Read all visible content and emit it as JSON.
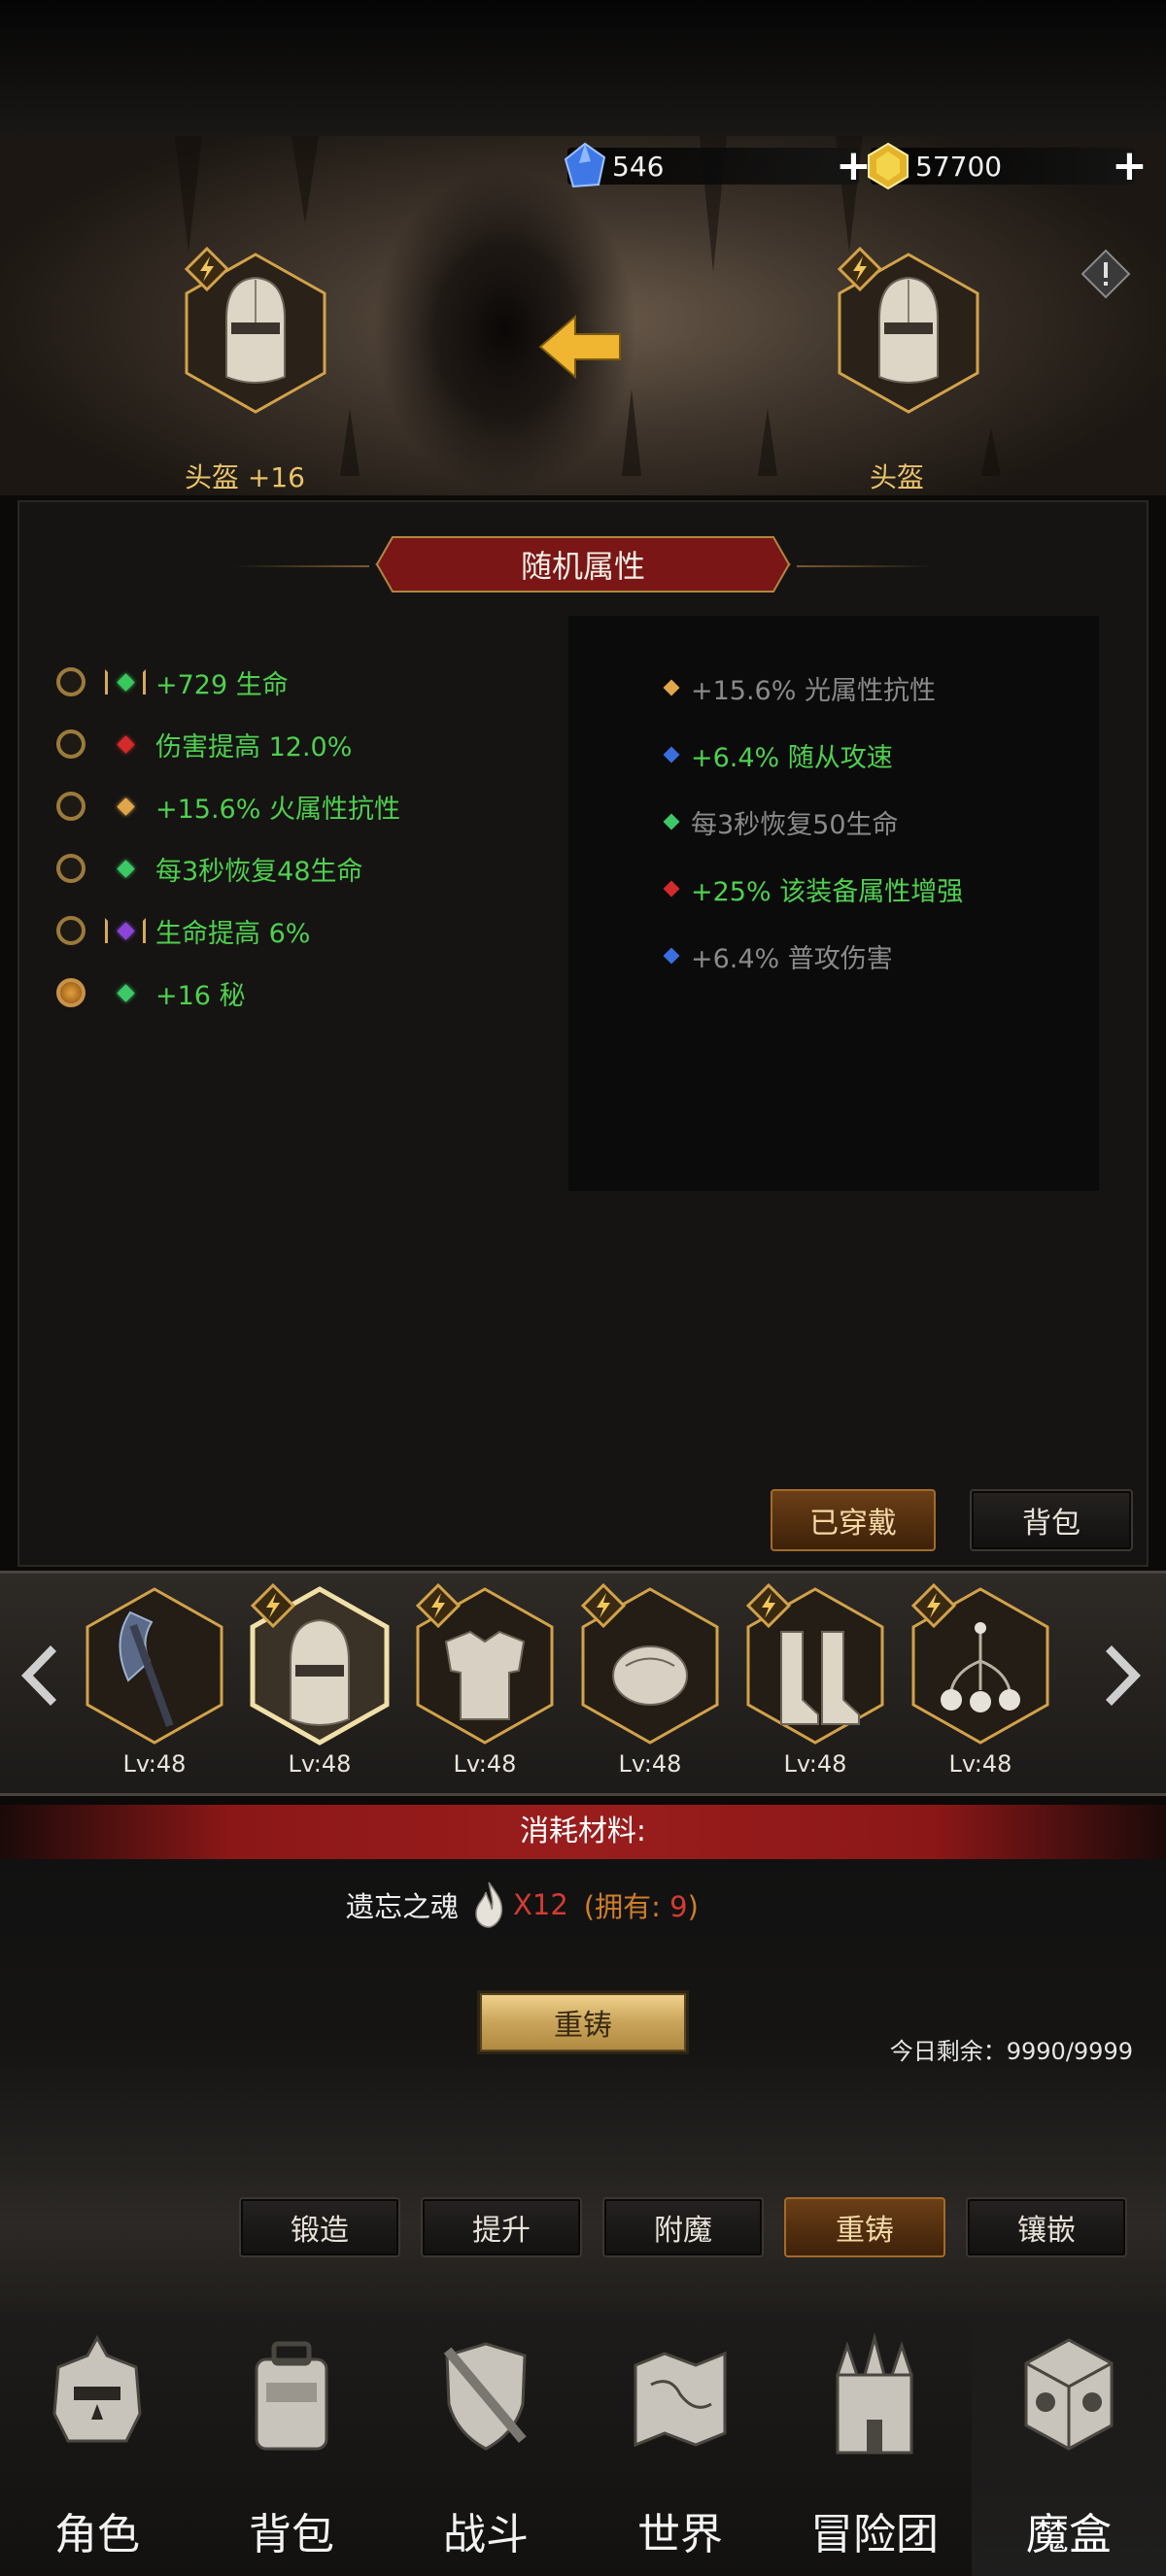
{
  "currency": {
    "diamonds": "546",
    "gold": "57700"
  },
  "compare": {
    "left_label": "头盔 +16",
    "right_label": "头盔"
  },
  "section_title": "随机属性",
  "current_attributes": [
    {
      "text": "+729 生命",
      "color": "#4fd04f",
      "gem": "#39c85a",
      "bracketed": true,
      "bracket_color": "#d7a95a"
    },
    {
      "text": "伤害提高 12.0%",
      "color": "#4fd04f",
      "gem": "#d42a2a",
      "bracketed": false
    },
    {
      "text": "+15.6% 火属性抗性",
      "color": "#4fd04f",
      "gem": "#e0a64a",
      "bracketed": false
    },
    {
      "text": "每3秒恢复48生命",
      "color": "#4fd04f",
      "gem": "#3cc866",
      "bracketed": false
    },
    {
      "text": "生命提高 6%",
      "color": "#4fd04f",
      "gem": "#8b45d6",
      "bracketed": true,
      "bracket_color": "#d7a95a"
    },
    {
      "text": "+16 秘",
      "color": "#4fd04f",
      "gem": "#3cc866",
      "bracketed": false,
      "selected": true
    }
  ],
  "new_attributes": [
    {
      "text": "+15.6% 光属性抗性",
      "color": "#8a8a8a",
      "gem": "#e0a64a"
    },
    {
      "text": "+6.4% 随从攻速",
      "color": "#4fd04f",
      "gem": "#3a6ee0"
    },
    {
      "text": "每3秒恢复50生命",
      "color": "#8a8a8a",
      "gem": "#3cc866"
    },
    {
      "text": "+25% 该装备属性增强",
      "color": "#4fd04f",
      "gem": "#d42a2a"
    },
    {
      "text": "+6.4% 普攻伤害",
      "color": "#8a8a8a",
      "gem": "#3a6ee0"
    }
  ],
  "buttons": {
    "equipped": "已穿戴",
    "bag": "背包"
  },
  "equipment": [
    {
      "level": "Lv:48",
      "icon": "axe-icon"
    },
    {
      "level": "Lv:48",
      "icon": "helmet-icon"
    },
    {
      "level": "Lv:48",
      "icon": "armor-icon"
    },
    {
      "level": "Lv:48",
      "icon": "gauntlet-icon"
    },
    {
      "level": "Lv:48",
      "icon": "boots-icon"
    },
    {
      "level": "Lv:48",
      "icon": "amulet-icon"
    }
  ],
  "consumption": {
    "title": "消耗材料:",
    "material_name": "遗忘之魂",
    "quantity": "X12",
    "owned_prefix": "(拥有: ",
    "owned_count": "9",
    "owned_suffix": ")"
  },
  "reforge_button": "重铸",
  "daily_remaining": "今日剩余：9990/9999",
  "tabs": [
    {
      "label": "锻造",
      "active": false
    },
    {
      "label": "提升",
      "active": false
    },
    {
      "label": "附魔",
      "active": false
    },
    {
      "label": "重铸",
      "active": true
    },
    {
      "label": "镶嵌",
      "active": false
    }
  ],
  "nav": [
    {
      "label": "角色",
      "icon": "character-icon"
    },
    {
      "label": "背包",
      "icon": "backpack-icon"
    },
    {
      "label": "战斗",
      "icon": "battle-icon"
    },
    {
      "label": "世界",
      "icon": "world-map-icon"
    },
    {
      "label": "冒险团",
      "icon": "castle-icon"
    },
    {
      "label": "魔盒",
      "icon": "magic-box-icon",
      "active": true
    }
  ]
}
